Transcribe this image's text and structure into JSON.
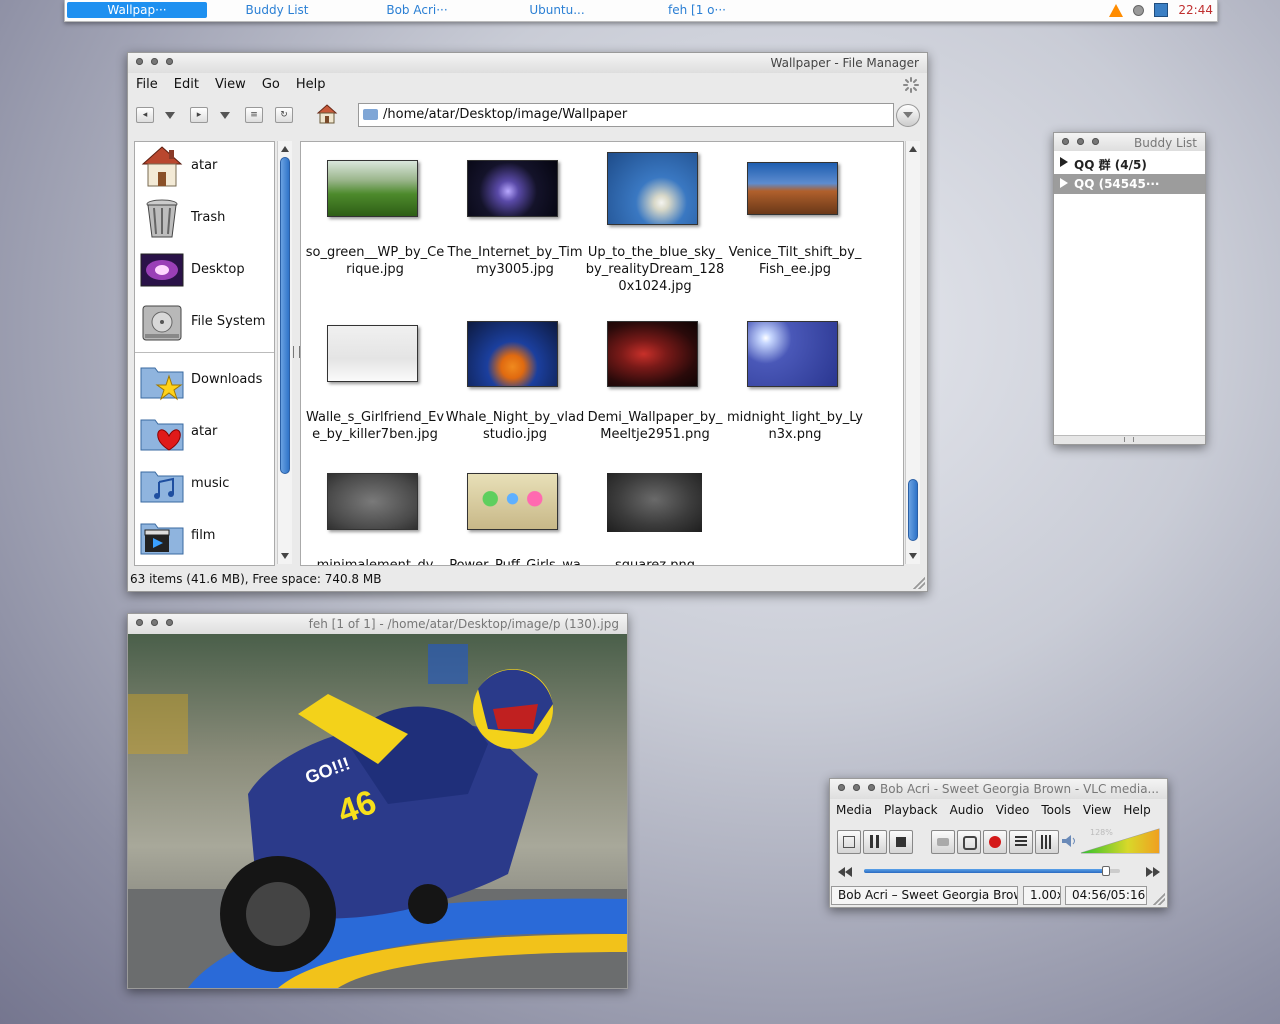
{
  "taskbar": {
    "tasks": [
      "Wallpap···",
      "Buddy List",
      "Bob Acri···",
      "Ubuntu...",
      "feh [1 o···"
    ],
    "clock": "22:44"
  },
  "file_manager": {
    "title": "Wallpaper - File Manager",
    "menu": [
      "File",
      "Edit",
      "View",
      "Go",
      "Help"
    ],
    "path": "/home/atar/Desktop/image/Wallpaper",
    "sidebar": [
      "atar",
      "Trash",
      "Desktop",
      "File System",
      "Downloads",
      "atar",
      "music",
      "film"
    ],
    "files": [
      "so_green__WP_by_Cerique.jpg",
      "The_Internet_by_Timmy3005.jpg",
      "Up_to_the_blue_sky_by_realityDream_1280x1024.jpg",
      "Venice_Tilt_shift_by_Fish_ee.jpg",
      "Walle_s_Girlfriend_Eve_by_killer7ben.jpg",
      "Whale_Night_by_vladstudio.jpg",
      "Demi_Wallpaper_by_Meeltje2951.png",
      "midnight_light_by_Lyn3x.png",
      "minimalement_dy",
      "Power_Puff_Girls_wa",
      "squarez.png"
    ],
    "status": "63 items (41.6 MB), Free space: 740.8 MB"
  },
  "buddy_list": {
    "title": "Buddy List",
    "groups": [
      "QQ 群 (4/5)",
      "QQ (54545···"
    ]
  },
  "feh": {
    "title": "feh [1 of 1] - /home/atar/Desktop/image/p (130).jpg"
  },
  "vlc": {
    "title": "Bob Acri - Sweet Georgia Brown - VLC media...",
    "menu": [
      "Media",
      "Playback",
      "Audio",
      "Video",
      "Tools",
      "View",
      "Help"
    ],
    "volume_label": "128%",
    "track": "Bob Acri – Sweet Georgia Brown",
    "speed": "1.00x",
    "time": "04:56/05:16",
    "progress": 0.94
  },
  "colors": {
    "accent": "#1e90f0",
    "clock": "#c03030"
  }
}
